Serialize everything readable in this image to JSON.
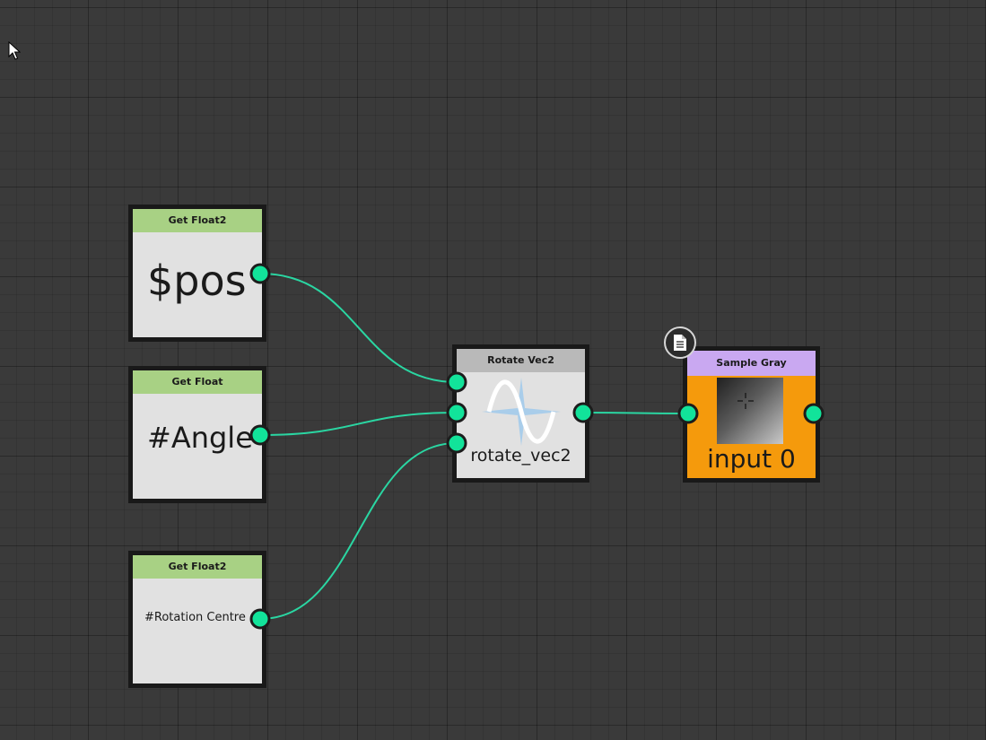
{
  "colors": {
    "canvas_bg": "#3a3a3a",
    "wire": "#2ad6a2",
    "port": "#12e39a",
    "node_border": "#191919",
    "node_body": "#e1e1e1",
    "header_green": "#a8d184",
    "header_gray": "#b9b9b9",
    "header_purple": "#c9a8f1",
    "sample_body": "#f59a0c"
  },
  "nodes": {
    "get_pos": {
      "title": "Get Float2",
      "value": "$pos"
    },
    "get_angle": {
      "title": "Get Float",
      "value": "#Angle"
    },
    "get_rotation_centre": {
      "title": "Get Float2",
      "value": "#Rotation Centre"
    },
    "rotate_vec2": {
      "title": "Rotate Vec2",
      "label": "rotate_vec2",
      "icon": "sine-wave-icon"
    },
    "sample_gray": {
      "title": "Sample Gray",
      "label": "input 0",
      "icon": "document-icon"
    }
  },
  "connections": [
    {
      "from": "get_pos.out",
      "to": "rotate_vec2.in1"
    },
    {
      "from": "get_angle.out",
      "to": "rotate_vec2.in2"
    },
    {
      "from": "get_rotation_centre.out",
      "to": "rotate_vec2.in3"
    },
    {
      "from": "rotate_vec2.out",
      "to": "sample_gray.in"
    }
  ]
}
